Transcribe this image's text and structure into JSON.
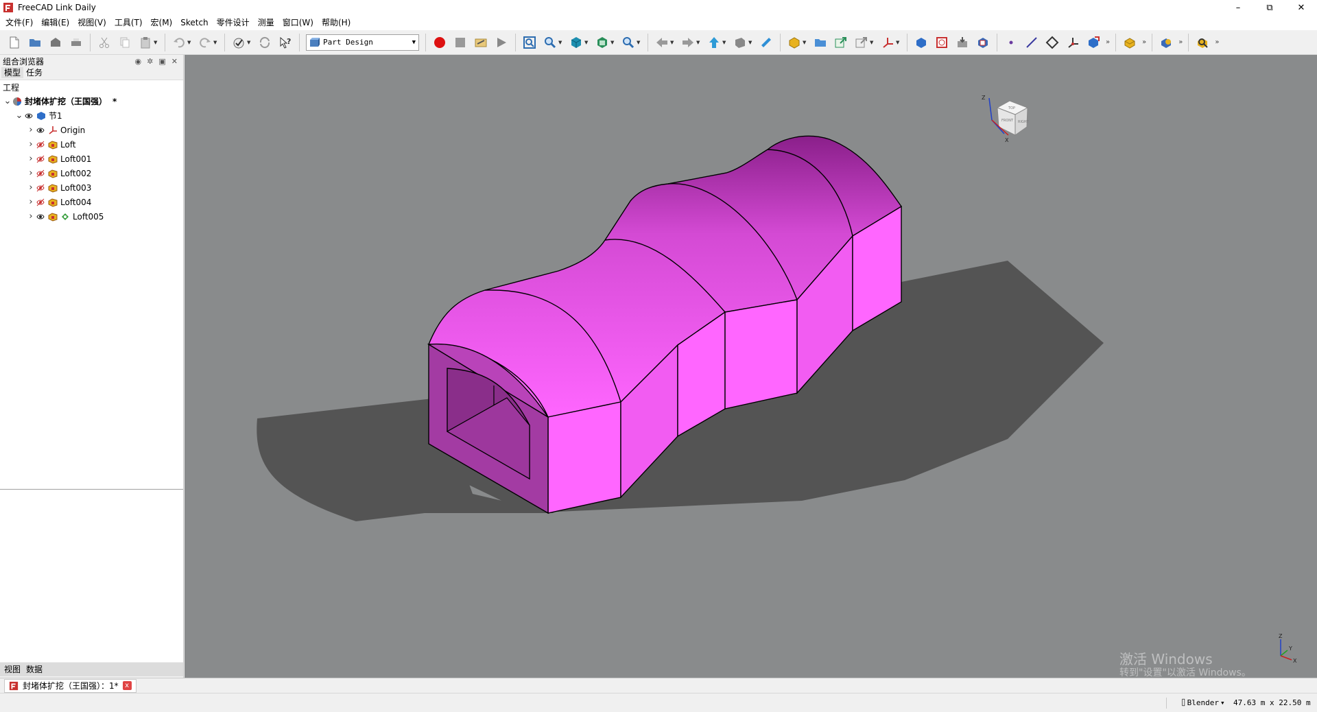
{
  "window": {
    "title": "FreeCAD Link Daily",
    "min_glyph": "–",
    "restore_glyph": "⧉",
    "close_glyph": "✕"
  },
  "menu": [
    "文件(F)",
    "编辑(E)",
    "视图(V)",
    "工具(T)",
    "宏(M)",
    "Sketch",
    "零件设计",
    "测量",
    "窗口(W)",
    "帮助(H)"
  ],
  "toolbar": {
    "workbench": "Part Design",
    "more_glyph": "»"
  },
  "combo_view": {
    "title": "组合浏览器",
    "tabs": [
      "模型",
      "任务"
    ],
    "tree_header": "工程",
    "bottom_tabs": [
      "视图",
      "数据"
    ],
    "tree": [
      {
        "label": "封堵体扩挖（王国强）",
        "suffix": "*",
        "level": 0,
        "expander": "v",
        "icon": "doc-icon",
        "bold": true
      },
      {
        "label": "节1",
        "level": 1,
        "expander": "v",
        "icon": "body-icon",
        "visible": true
      },
      {
        "label": "Origin",
        "level": 2,
        "expander": ">",
        "icon": "origin-icon",
        "visible": true
      },
      {
        "label": "Loft",
        "level": 2,
        "expander": ">",
        "icon": "loft-icon",
        "visible": false
      },
      {
        "label": "Loft001",
        "level": 2,
        "expander": ">",
        "icon": "loft-icon",
        "visible": false
      },
      {
        "label": "Loft002",
        "level": 2,
        "expander": ">",
        "icon": "loft-icon",
        "visible": false
      },
      {
        "label": "Loft003",
        "level": 2,
        "expander": ">",
        "icon": "loft-icon",
        "visible": false
      },
      {
        "label": "Loft004",
        "level": 2,
        "expander": ">",
        "icon": "loft-icon",
        "visible": false
      },
      {
        "label": "Loft005",
        "level": 2,
        "expander": ">",
        "icon": "loft-icon",
        "visible": true,
        "tip": true
      }
    ]
  },
  "viewport": {
    "background": "#898b8c",
    "model_color": "#ff66ff",
    "navcube": {
      "front": "FRONT",
      "right": "RIGHT",
      "top": "TOP",
      "axis_x": "X",
      "axis_z": "Z"
    },
    "axis": {
      "x": "X",
      "y": "Y",
      "z": "Z"
    },
    "watermark_line1": "激活 Windows",
    "watermark_line2": "转到\"设置\"以激活 Windows。"
  },
  "doc_tab": {
    "label": "封堵体扩挖（王国强）：1*",
    "close": "x"
  },
  "status": {
    "nav_style": "Blender",
    "dimensions": "47.63 m x 22.50 m"
  }
}
